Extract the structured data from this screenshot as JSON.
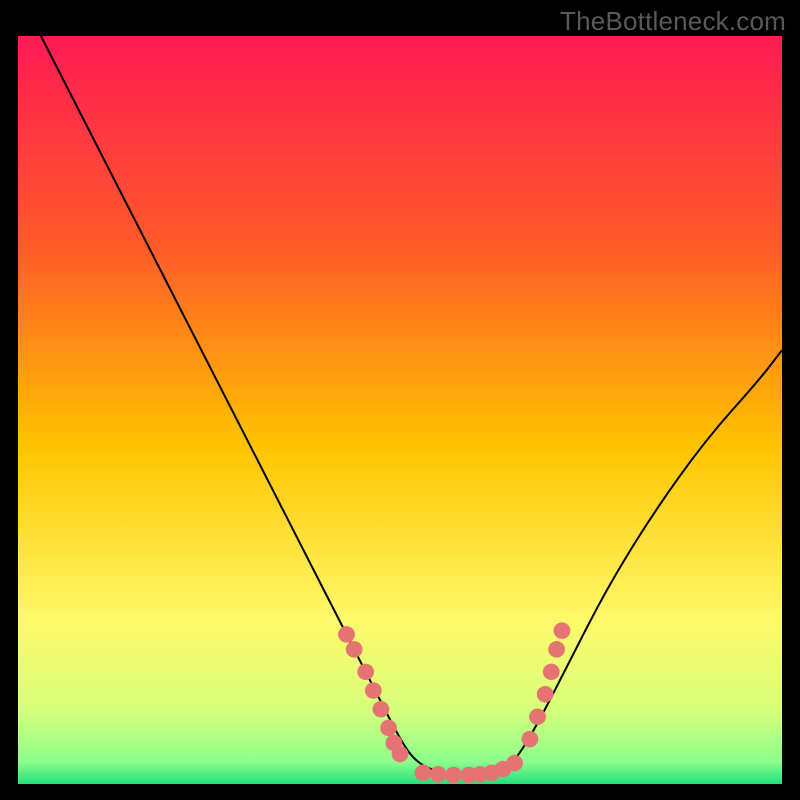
{
  "watermark": "TheBottleneck.com",
  "chart_data": {
    "type": "line",
    "title": "",
    "xlabel": "",
    "ylabel": "",
    "xlim": [
      0,
      100
    ],
    "ylim": [
      0,
      100
    ],
    "grid": false,
    "legend": false,
    "gradient_stops": [
      {
        "offset": 0.0,
        "color": "#ff1a54"
      },
      {
        "offset": 0.28,
        "color": "#ff5a2a"
      },
      {
        "offset": 0.55,
        "color": "#ffc400"
      },
      {
        "offset": 0.78,
        "color": "#fff96a"
      },
      {
        "offset": 0.9,
        "color": "#d7ff7a"
      },
      {
        "offset": 0.97,
        "color": "#8cff8c"
      },
      {
        "offset": 1.0,
        "color": "#22e07c"
      }
    ],
    "series": [
      {
        "name": "bottleneck-curve",
        "color": "#000000",
        "x": [
          3,
          8,
          14,
          20,
          26,
          32,
          38,
          43,
          47,
          50,
          52,
          55,
          58,
          60,
          63,
          65,
          68,
          72,
          77,
          83,
          90,
          97,
          100
        ],
        "y": [
          100,
          90,
          78,
          66,
          54,
          42,
          30,
          20,
          12,
          6,
          3,
          1.5,
          1.2,
          1.2,
          1.5,
          3,
          8,
          16,
          26,
          36,
          46,
          54,
          58
        ]
      }
    ],
    "dot_clusters": {
      "color": "#e57373",
      "radius_pct": 1.1,
      "left": [
        [
          43,
          20
        ],
        [
          44,
          18
        ],
        [
          45.5,
          15
        ],
        [
          46.5,
          12.5
        ],
        [
          47.5,
          10
        ],
        [
          48.5,
          7.5
        ],
        [
          49.2,
          5.5
        ],
        [
          50,
          4
        ]
      ],
      "bottom": [
        [
          53,
          1.5
        ],
        [
          55,
          1.3
        ],
        [
          57,
          1.2
        ],
        [
          59,
          1.2
        ],
        [
          60.5,
          1.3
        ],
        [
          62,
          1.5
        ],
        [
          63.5,
          2
        ],
        [
          65,
          2.8
        ]
      ],
      "right": [
        [
          67,
          6
        ],
        [
          68,
          9
        ],
        [
          69,
          12
        ],
        [
          69.8,
          15
        ],
        [
          70.5,
          18
        ],
        [
          71.2,
          20.5
        ]
      ]
    }
  }
}
